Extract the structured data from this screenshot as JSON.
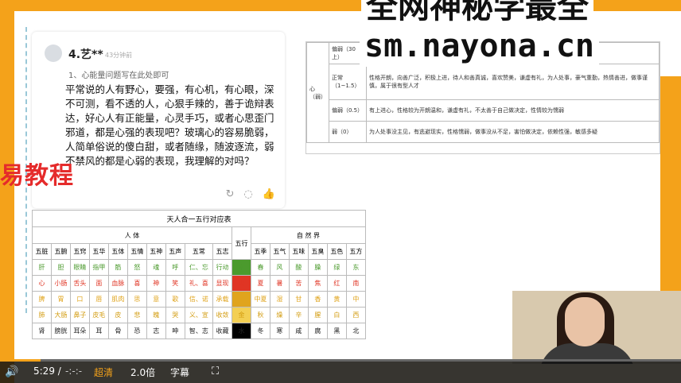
{
  "comment": {
    "username": "4.艺**",
    "time": "43分钟前",
    "note": "1、心能量问题写在此处即可",
    "body": "平常说的人有野心，要强，有心机，有心眼，深不可测，看不透的人，心狠手辣的，善于诡辩表达，好心人有正能量，心灵手巧，或者心思歪门邪道，都是心强的表现吧？玻璃心的容易脆弱，人简单俗说的傻白甜，或者随缘，随波逐流，弱不禁风的都是心弱的表现，我理解的对吗？",
    "icons": [
      "share-icon",
      "comment-icon",
      "like-icon"
    ]
  },
  "left_watermark": "易教程",
  "watermark": {
    "line1": "全网神秘学最全",
    "line2": "sm.nayona.cn"
  },
  "doc": {
    "side_label": "心（弱）",
    "rows": [
      {
        "k": "偏弱（30上）",
        "v": ""
      },
      {
        "k": "正常（1~1.5）",
        "v": "性格开朗，向善广泛，积极上进，待人和善真诚，喜欢赞美，谦虚有礼，为人处事，豪气重勤，热情善进，做事谨慎，属于很有型人才"
      },
      {
        "k": "偏弱（0.5）",
        "v": "有上进心，性格较为开朗温和，谦虚有礼，不太善于自己做决定，性情较为懦弱"
      },
      {
        "k": "弱（0）",
        "v": "为人处事没主见，有逃避现实，性格懦弱，做事没从不足，害怕做决定，依赖性强，敏感多疑"
      }
    ]
  },
  "table": {
    "title": "天人合一五行对应表",
    "group_human": "人 体",
    "group_center": "五行",
    "group_nature": "自 然 界",
    "human_headers": [
      "五脏",
      "五腑",
      "五窍",
      "五华",
      "五体",
      "五情",
      "五神",
      "五声",
      "五常",
      "五志"
    ],
    "nature_headers": [
      "五季",
      "五气",
      "五味",
      "五臭",
      "五色",
      "五方"
    ],
    "rows": [
      {
        "cls": "wood",
        "el": "木",
        "human": [
          "肝",
          "胆",
          "眼睛",
          "指甲",
          "筋",
          "怒",
          "魂",
          "呼",
          "仁、忘",
          "行动"
        ],
        "nature": [
          "春",
          "风",
          "酸",
          "臊",
          "绿",
          "东"
        ]
      },
      {
        "cls": "fire",
        "el": "火",
        "human": [
          "心",
          "小肠",
          "舌头",
          "面",
          "血脉",
          "喜",
          "神",
          "笑",
          "礼、喜",
          "显现"
        ],
        "nature": [
          "夏",
          "暑",
          "苦",
          "焦",
          "红",
          "南"
        ]
      },
      {
        "cls": "earth",
        "el": "土",
        "human": [
          "脾",
          "胃",
          "口",
          "唇",
          "肌肉",
          "思",
          "意",
          "歌",
          "信、诺",
          "承载"
        ],
        "nature": [
          "中夏",
          "湿",
          "甘",
          "香",
          "黄",
          "中"
        ]
      },
      {
        "cls": "metal",
        "el": "金",
        "human": [
          "肺",
          "大肠",
          "鼻子",
          "皮毛",
          "皮",
          "悲",
          "魄",
          "哭",
          "义、宣",
          "收敛"
        ],
        "nature": [
          "秋",
          "燥",
          "辛",
          "腥",
          "白",
          "西"
        ]
      },
      {
        "cls": "water",
        "el": "水",
        "human": [
          "肾",
          "膀胱",
          "耳朵",
          "耳",
          "骨",
          "恐",
          "志",
          "呻",
          "智、志",
          "收藏"
        ],
        "nature": [
          "冬",
          "寒",
          "咸",
          "腐",
          "黑",
          "北"
        ]
      }
    ]
  },
  "player": {
    "time": "5:29 /",
    "duration": "-:-:-",
    "quality": "超清",
    "speed": "2.0倍",
    "subtitle": "字幕",
    "progress": 0.06,
    "accent": "#f4a21a"
  }
}
